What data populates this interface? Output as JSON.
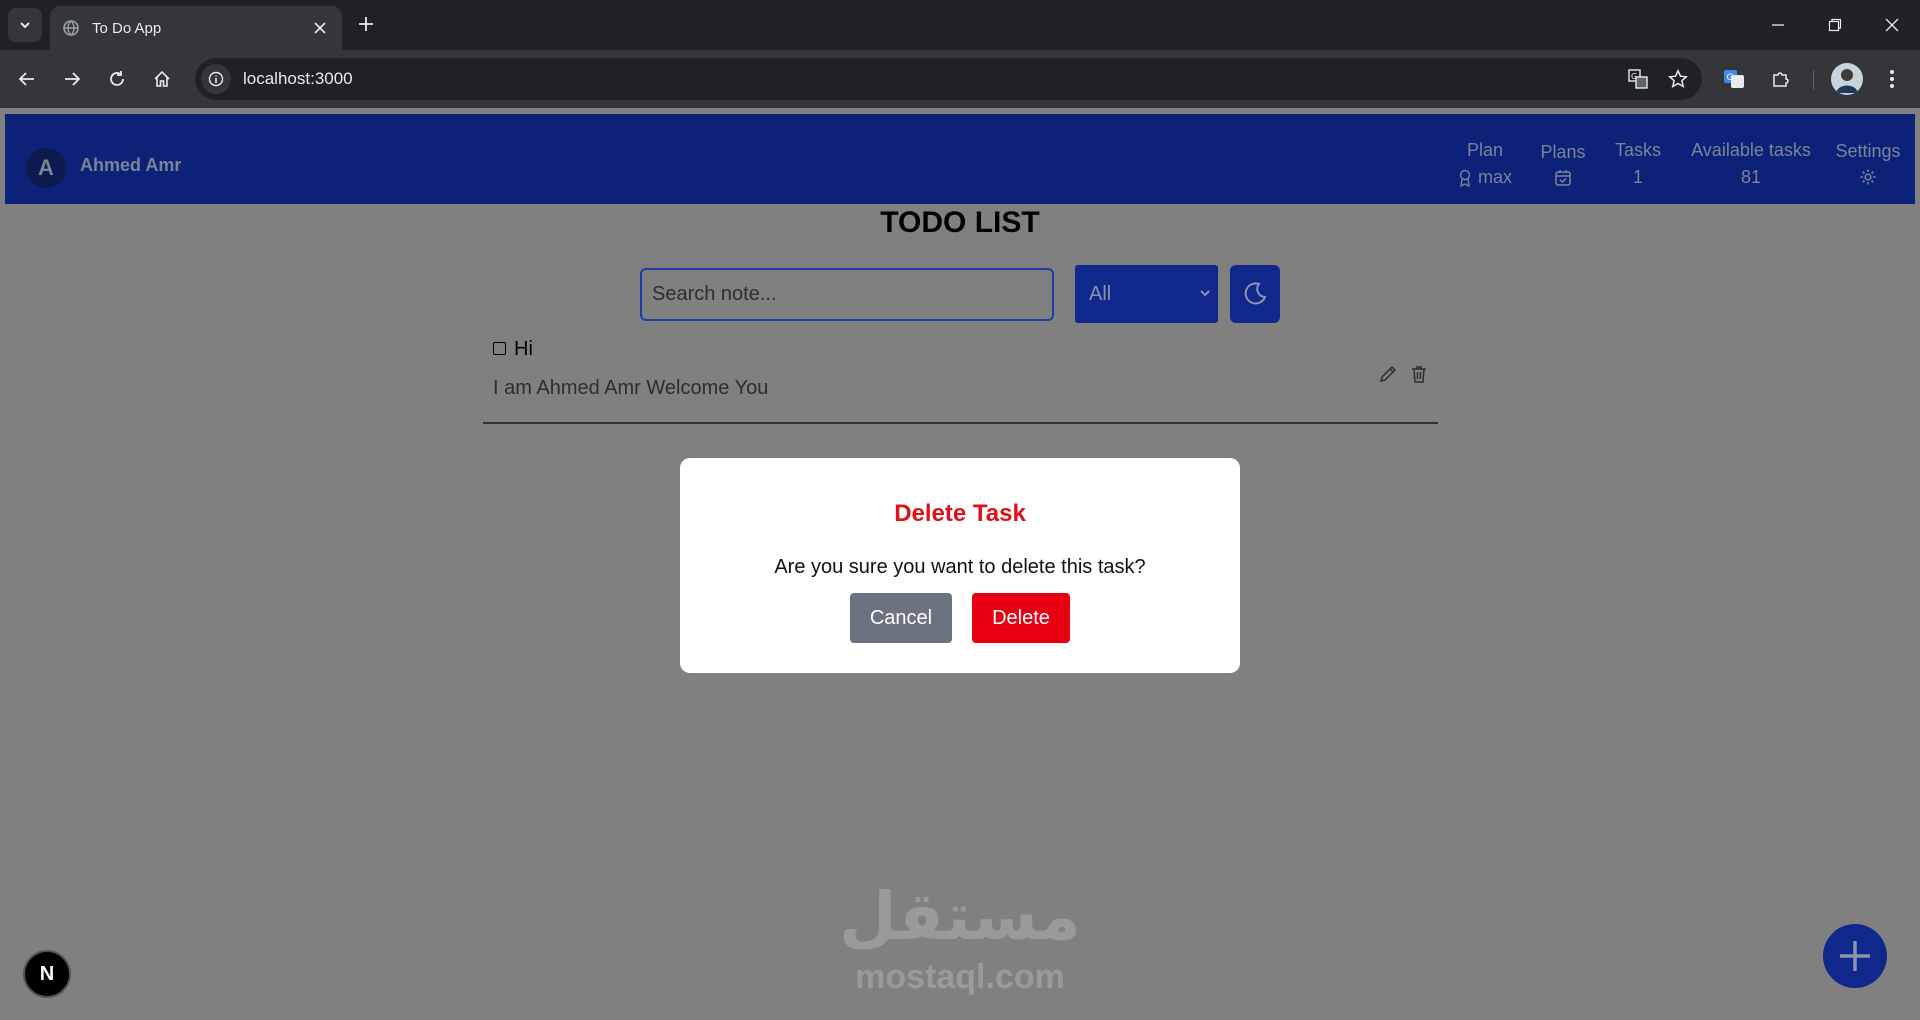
{
  "browser": {
    "tab_title": "To Do App",
    "url": "localhost:3000"
  },
  "header": {
    "avatar_initial": "A",
    "user_name": "Ahmed Amr",
    "stats": [
      {
        "label": "Plan",
        "value": "max",
        "icon": "award-icon"
      },
      {
        "label": "Plans",
        "value": "",
        "icon": "calendar-check-icon"
      },
      {
        "label": "Tasks",
        "value": "1"
      },
      {
        "label": "Available tasks",
        "value": "81"
      },
      {
        "label": "Settings",
        "value": "",
        "icon": "gear-icon"
      }
    ]
  },
  "main": {
    "title": "TODO LIST",
    "search_placeholder": "Search note...",
    "filter_selected": "All",
    "theme_icon": "moon-icon"
  },
  "tasks": [
    {
      "title": "Hi",
      "description": "I am Ahmed Amr Welcome You",
      "done": false
    }
  ],
  "modal": {
    "title": "Delete Task",
    "message": "Are you sure you want to delete this task?",
    "cancel_label": "Cancel",
    "delete_label": "Delete"
  },
  "watermark": {
    "arabic": "مستقل",
    "latin": "mostaql.com"
  },
  "floating": {
    "badge_letter": "N",
    "fab_icon": "plus-icon"
  },
  "colors": {
    "appbar": "#0c2278",
    "danger": "#e60012",
    "cancel": "#6b7280",
    "overlay": "#808080"
  }
}
